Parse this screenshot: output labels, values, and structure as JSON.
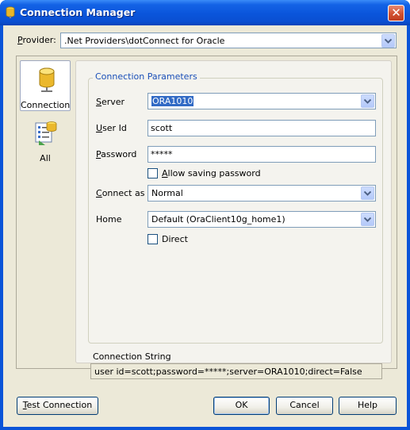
{
  "window": {
    "title": "Connection Manager",
    "close_glyph": "✕",
    "title_color": "#ffffff",
    "titlebar_color": "#0a55db"
  },
  "provider": {
    "label": "Provider:",
    "value": ".Net Providers\\dotConnect for Oracle"
  },
  "nav": {
    "items": [
      {
        "label": "Connection",
        "icon": "database-icon",
        "selected": true
      },
      {
        "label": "All",
        "icon": "properties-list-icon",
        "selected": false
      }
    ]
  },
  "params": {
    "legend": "Connection Parameters",
    "server_label": "Server",
    "server_value": "ORA1010",
    "userid_label": "User Id",
    "userid_value": "scott",
    "password_label": "Password",
    "password_value": "*****",
    "allow_saving_label": "Allow saving password",
    "allow_saving_checked": false,
    "connect_as_label": "Connect as",
    "connect_as_value": "Normal",
    "home_label": "Home",
    "home_value": "Default (OraClient10g_home1)",
    "direct_label": "Direct",
    "direct_checked": false
  },
  "connection_string": {
    "label": "Connection String",
    "value": "user id=scott;password=*****;server=ORA1010;direct=False"
  },
  "buttons": {
    "test": "Test Connection",
    "ok": "OK",
    "cancel": "Cancel",
    "help": "Help"
  },
  "colors": {
    "legend_text": "#1a4fb8",
    "selection_highlight": "#316ac5",
    "face": "#ece9d8"
  }
}
